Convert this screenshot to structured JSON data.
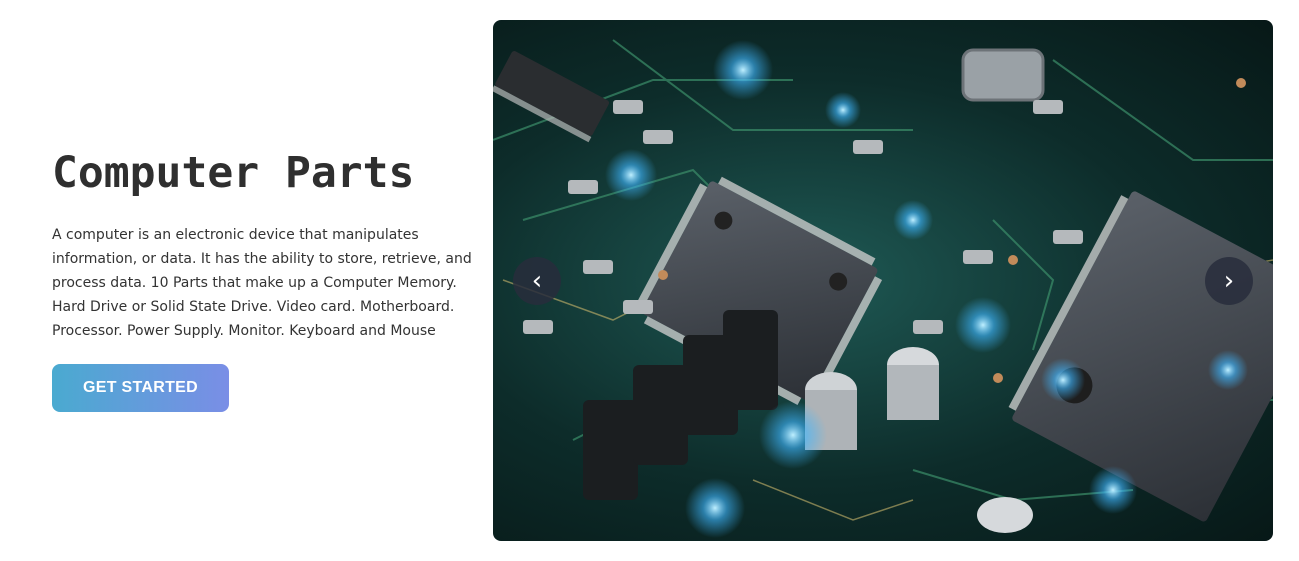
{
  "hero": {
    "title": "Computer Parts",
    "description": "A computer is an electronic device that manipulates information, or data. It has the ability to store, retrieve, and process data. 10 Parts that make up a Computer Memory. Hard Drive or Solid State Drive. Video card. Motherboard. Processor. Power Supply. Monitor. Keyboard and Mouse",
    "cta_label": "GET STARTED"
  },
  "carousel": {
    "prev_icon": "‹",
    "next_icon": "›",
    "image": "circuit-board-photo"
  },
  "colors": {
    "cta_start": "#4aaad0",
    "cta_end": "#7a8ee6",
    "title": "#2f2f2f",
    "board_green": "#0d2c2a",
    "glow": "#3fb7ff"
  }
}
